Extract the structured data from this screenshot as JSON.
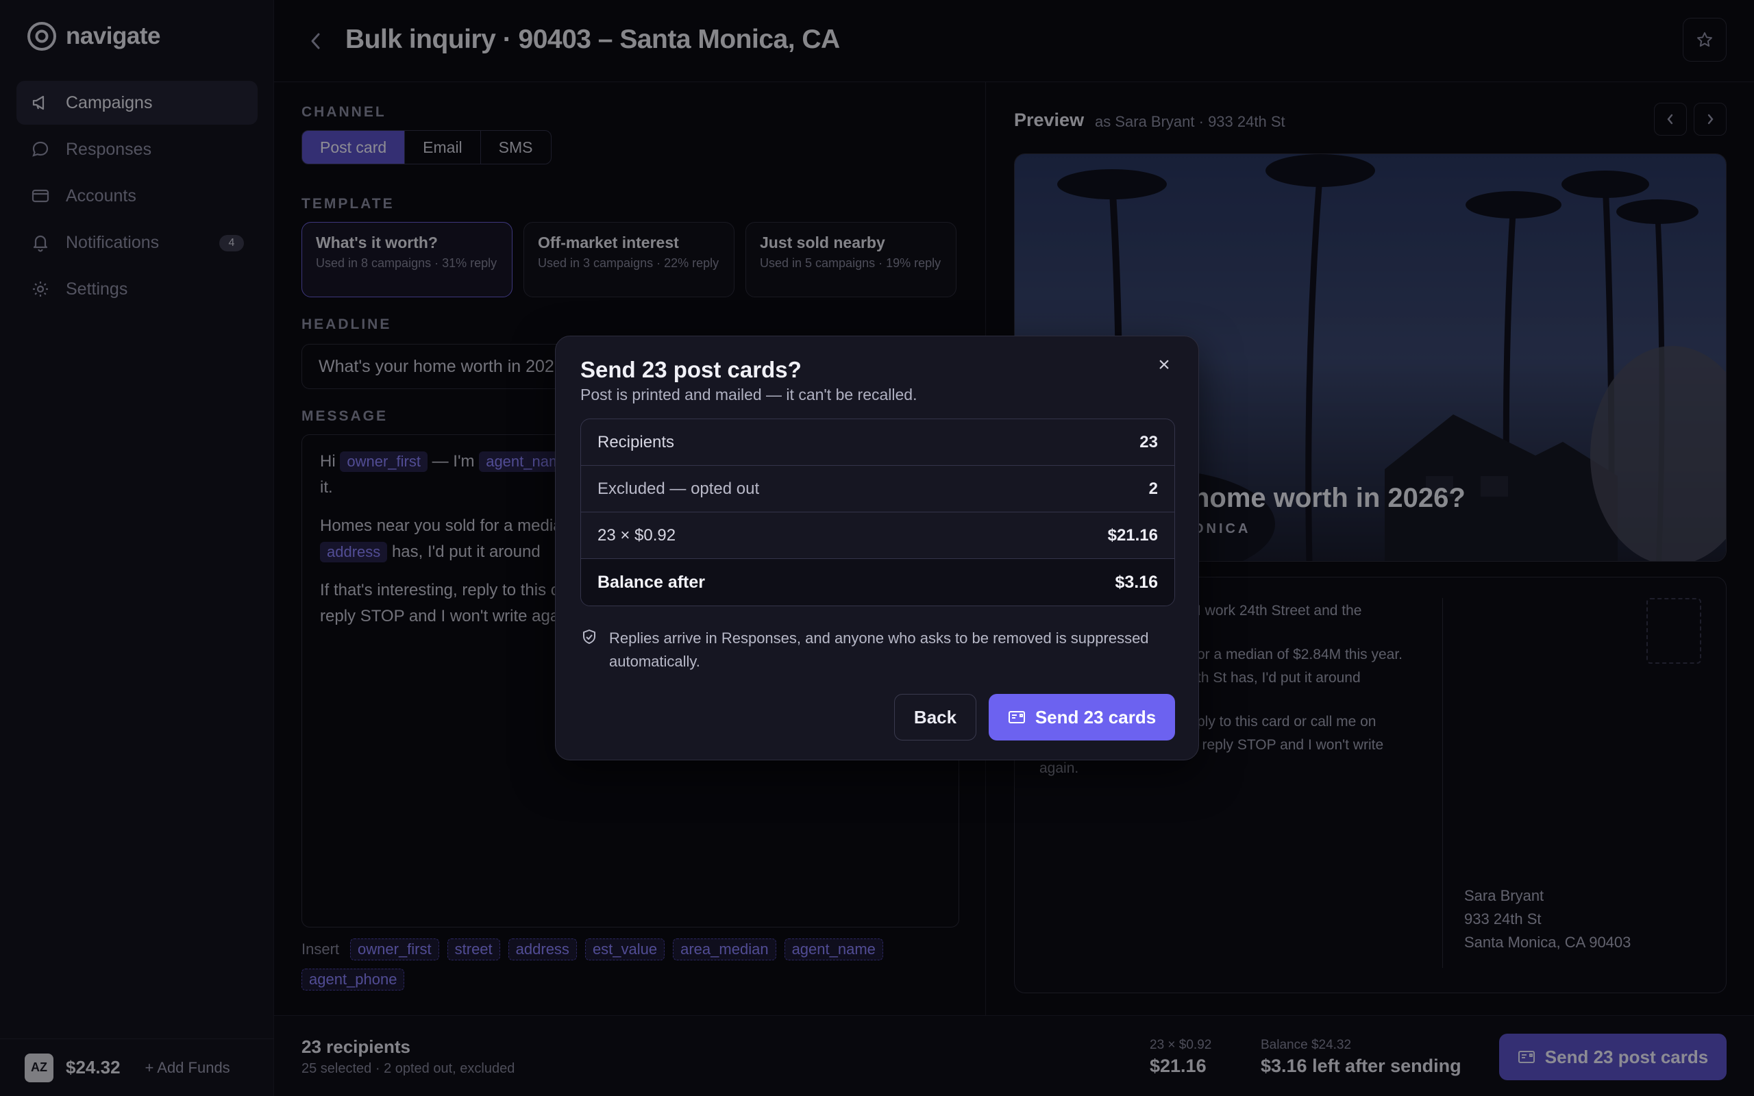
{
  "app": {
    "name": "navigate"
  },
  "sidebar": {
    "items": [
      {
        "label": "Campaigns",
        "icon": "megaphone-icon",
        "active": true
      },
      {
        "label": "Responses",
        "icon": "chat-bubble-icon"
      },
      {
        "label": "Accounts",
        "icon": "credit-card-icon"
      },
      {
        "label": "Notifications",
        "icon": "bell-icon",
        "badge": "4"
      },
      {
        "label": "Settings",
        "icon": "gear-icon"
      }
    ],
    "footer": {
      "avatar_initials": "AZ",
      "balance": "$24.32",
      "add_funds": "+ Add Funds"
    }
  },
  "header": {
    "title": "Bulk inquiry · 90403 – Santa Monica, CA"
  },
  "editor": {
    "channel_label": "CHANNEL",
    "channels": [
      "Post card",
      "Email",
      "SMS"
    ],
    "selected_channel": "Post card",
    "template_label": "TEMPLATE",
    "templates": [
      {
        "name": "What's it worth?",
        "meta": "Used in 8 campaigns · 31% reply"
      },
      {
        "name": "Off-market interest",
        "meta": "Used in 3 campaigns · 22% reply"
      },
      {
        "name": "Just sold nearby",
        "meta": "Used in 5 campaigns · 19% reply"
      }
    ],
    "headline_label": "HEADLINE",
    "headline_value": "What's your home worth in 2026?",
    "message_label": "MESSAGE",
    "message": {
      "p1_a": "Hi",
      "p1_tok1": "owner_first",
      "p1_b": "— I'm",
      "p1_tok2": "agent_name",
      "p1_c": "it.",
      "p2_a": "Homes near you sold for a median of",
      "p2_tok1": "address",
      "p2_b": "has, I'd put it around",
      "p3_a": "If that's interesting, reply to this card or call me on",
      "p3_b": "reply STOP and I won't write again."
    },
    "insert_label": "Insert",
    "insert_tokens": [
      "owner_first",
      "street",
      "address",
      "est_value",
      "area_median",
      "agent_name",
      "agent_phone"
    ]
  },
  "preview": {
    "title": "Preview",
    "subtitle": "as Sara Bryant · 933 24th St",
    "photo_headline": "home worth in 2026?",
    "photo_area": "ONICA",
    "card_lines": [
      "I work 24th Street and the",
      "or a median of $2.84M this year.",
      "th St has, I'd put it around",
      "ply to this card or call me on",
      "(310) 555-0148. If it isn't, reply STOP and I won't write",
      "again."
    ],
    "address": [
      "Sara Bryant",
      "933 24th St",
      "Santa Monica, CA 90403"
    ]
  },
  "footbar": {
    "recipients": "23 recipients",
    "recipients_sub": "25 selected · 2 opted out, excluded",
    "cost_label": "23 × $0.92",
    "cost_value": "$21.16",
    "balance_label": "Balance $24.32",
    "balance_value": "$3.16 left after sending",
    "send_label": "Send 23 post cards"
  },
  "modal": {
    "title": "Send 23 post cards?",
    "subtitle": "Post is printed and mailed — it can't be recalled.",
    "rows": [
      {
        "k": "Recipients",
        "v": "23"
      },
      {
        "k": "Excluded — opted out",
        "v": "2"
      },
      {
        "k": "23 × $0.92",
        "v": "$21.16"
      },
      {
        "k": "Balance after",
        "v": "$3.16"
      }
    ],
    "note": "Replies arrive in Responses, and anyone who asks to be removed is suppressed automatically.",
    "back_label": "Back",
    "send_label": "Send 23 cards",
    "close_glyph": "×"
  },
  "colors": {
    "accent": "#6c62f0",
    "accent_muted": "#5b52c6",
    "bg": "#0b0b12",
    "token": "#8c84ff"
  }
}
